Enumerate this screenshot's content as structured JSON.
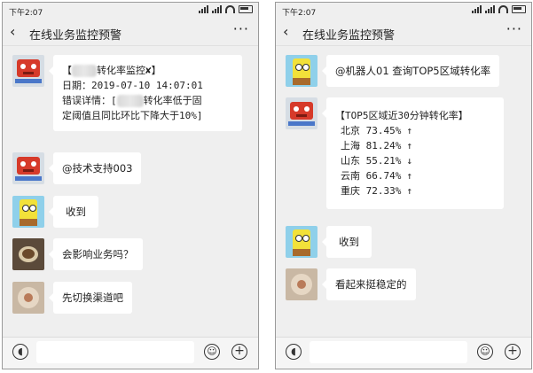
{
  "status_bar": {
    "time": "下午2:07"
  },
  "header": {
    "back": "‹",
    "title": "在线业务监控预警",
    "more": "···"
  },
  "left": {
    "alert": {
      "line1_prefix": "【",
      "line1_suffix": "转化率监控✘】",
      "line2": "日期：2019-07-10 14:07:01",
      "line3_prefix": "错误详情：[",
      "line3_suffix": "转化率低于固",
      "line4": "定阈值且同比环比下降大于10%]"
    },
    "mention": "@技术支持003",
    "reply1": "收到",
    "question": "会影响业务吗？",
    "suggestion": "先切换渠道吧"
  },
  "right": {
    "query": "@机器人01 查询TOP5区域转化率",
    "report_title": "【TOP5区域近30分钟转化率】",
    "regions": [
      {
        "name": "北京",
        "rate": "73.45%",
        "trend": "↑"
      },
      {
        "name": "上海",
        "rate": "81.24%",
        "trend": "↑"
      },
      {
        "name": "山东",
        "rate": "55.21%",
        "trend": "↓"
      },
      {
        "name": "云南",
        "rate": "66.74%",
        "trend": "↑"
      },
      {
        "name": "重庆",
        "rate": "72.33%",
        "trend": "↑"
      }
    ],
    "reply": "收到",
    "comment": "看起来挺稳定的"
  },
  "icons": {
    "voice": "voice-icon",
    "emoji": "emoji-icon",
    "plus": "plus-icon"
  }
}
